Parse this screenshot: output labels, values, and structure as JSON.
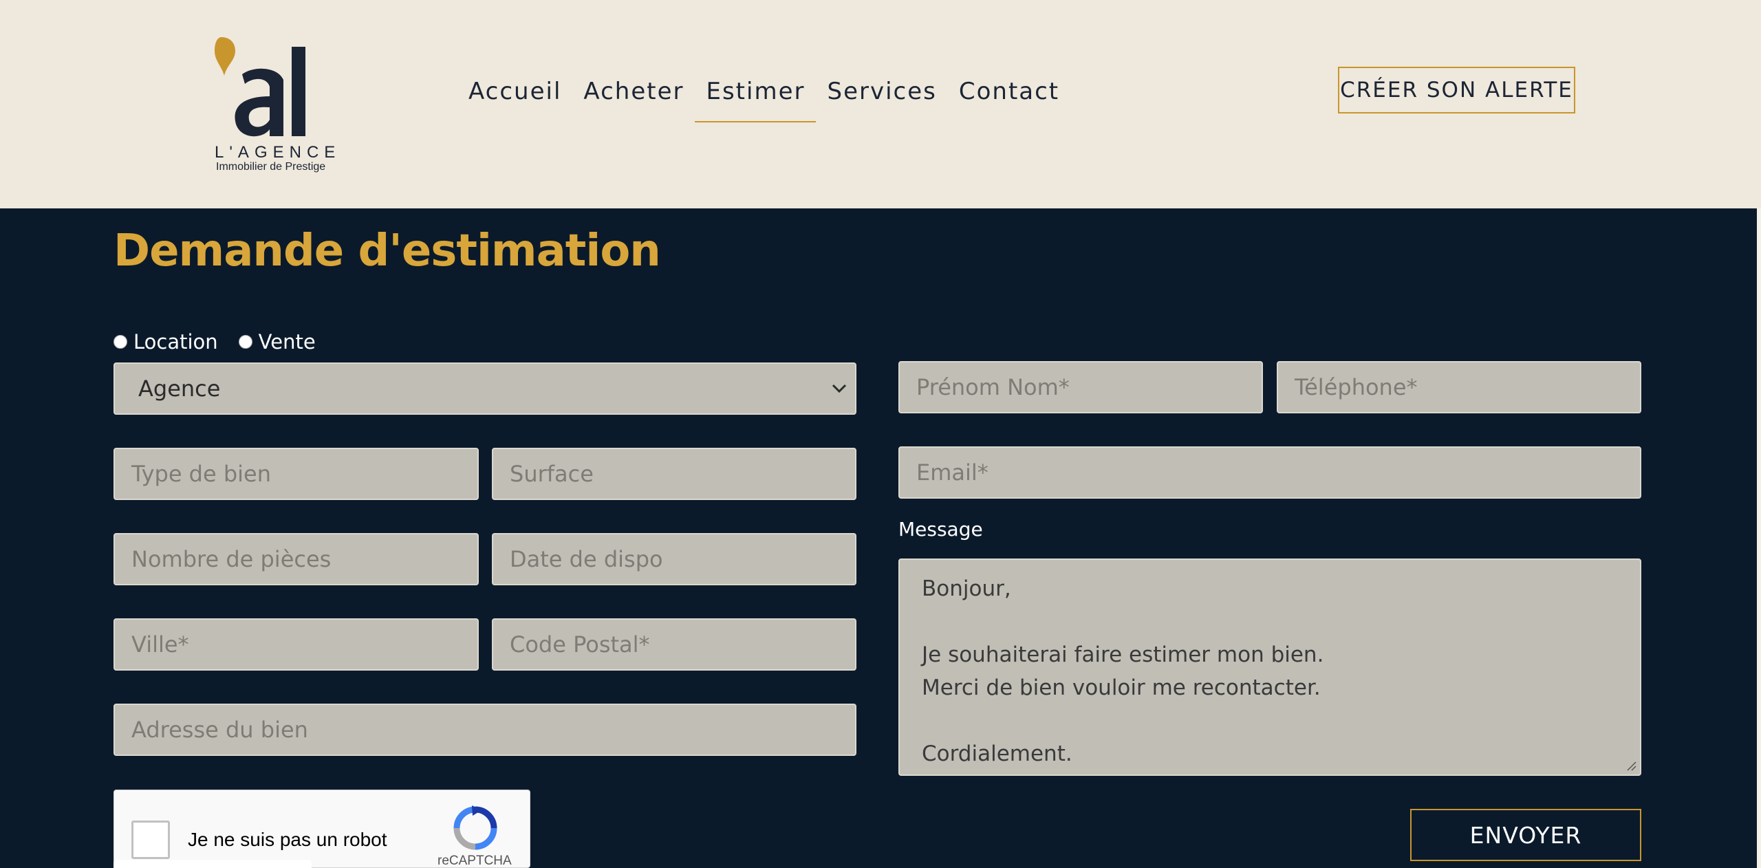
{
  "header": {
    "logo": {
      "line1": "L'AGENCE",
      "line2": "Immobilier de Prestige"
    },
    "nav": [
      {
        "label": "Accueil"
      },
      {
        "label": "Acheter"
      },
      {
        "label": "Estimer",
        "active": true
      },
      {
        "label": "Services"
      },
      {
        "label": "Contact"
      }
    ],
    "cta_label": "CRÉER SON ALERTE"
  },
  "form": {
    "title": "Demande d'estimation",
    "radios": [
      {
        "label": "Location",
        "checked": false
      },
      {
        "label": "Vente",
        "checked": false
      }
    ],
    "agency_select": "Agence",
    "fields": {
      "type_de_bien": "Type de bien",
      "surface": "Surface",
      "nombre_pieces": "Nombre de pièces",
      "date_dispo": "Date de dispo",
      "ville": "Ville*",
      "code_postal": "Code Postal*",
      "adresse": "Adresse du bien",
      "prenom_nom": "Prénom Nom*",
      "telephone": "Téléphone*",
      "email": "Email*"
    },
    "message_label": "Message",
    "message_lines": [
      "Bonjour,",
      "",
      "Je souhaiterai faire estimer mon bien.",
      "Merci de bien vouloir me recontacter.",
      "",
      "Cordialement."
    ],
    "send_label": "ENVOYER",
    "captcha": {
      "label": "Je ne suis pas un robot",
      "brand": "reCAPTCHA"
    }
  },
  "colors": {
    "header_bg": "#efe8dc",
    "main_bg": "#0b1a2b",
    "gold": "#c9962d",
    "title_gold": "#d8a63a",
    "field_bg": "#c1beb6"
  }
}
